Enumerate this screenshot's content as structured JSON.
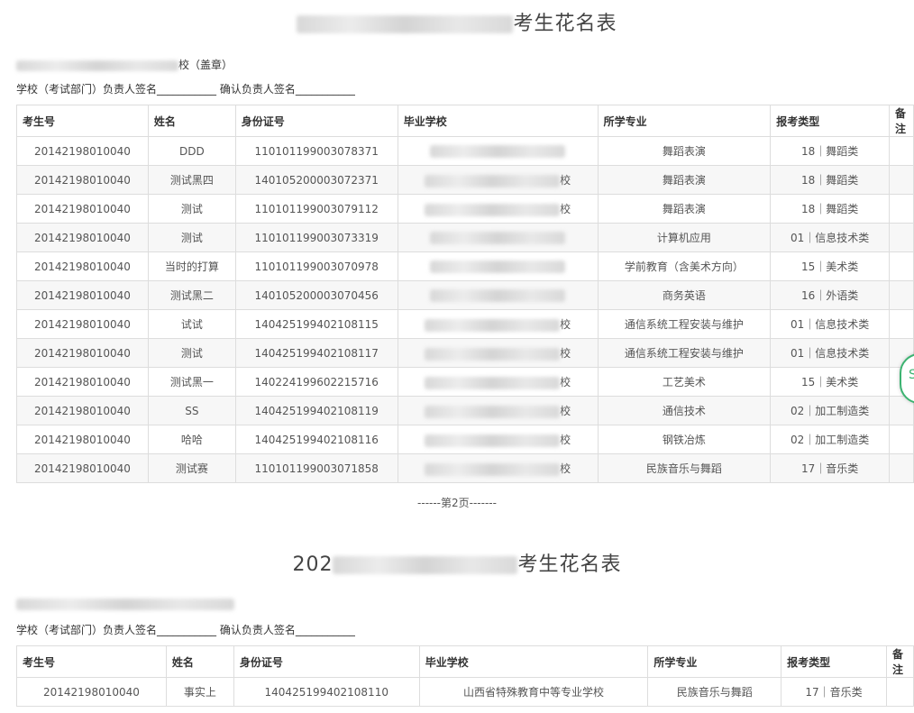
{
  "sheet1": {
    "title_suffix": "考生花名表",
    "school_suffix": "校（盖章）",
    "sign_line": "学校（考试部门）负责人签名___________ 确认负责人签名___________",
    "headers": [
      "考生号",
      "姓名",
      "身份证号",
      "毕业学校",
      "所学专业",
      "报考类型",
      "备注"
    ],
    "rows": [
      [
        "20142198010040",
        "DDD",
        "110101199003078371",
        "",
        "舞蹈表演",
        "18｜舞蹈类",
        ""
      ],
      [
        "20142198010040",
        "测试黑四",
        "140105200003072371",
        "校",
        "舞蹈表演",
        "18｜舞蹈类",
        ""
      ],
      [
        "20142198010040",
        "测试",
        "110101199003079112",
        "校",
        "舞蹈表演",
        "18｜舞蹈类",
        ""
      ],
      [
        "20142198010040",
        "测试",
        "110101199003073319",
        "",
        "计算机应用",
        "01｜信息技术类",
        ""
      ],
      [
        "20142198010040",
        "当时的打算",
        "110101199003070978",
        "",
        "学前教育（含美术方向）",
        "15｜美术类",
        ""
      ],
      [
        "20142198010040",
        "测试黑二",
        "140105200003070456",
        "",
        "商务英语",
        "16｜外语类",
        ""
      ],
      [
        "20142198010040",
        "试试",
        "140425199402108115",
        "校",
        "通信系统工程安装与维护",
        "01｜信息技术类",
        ""
      ],
      [
        "20142198010040",
        "测试",
        "140425199402108117",
        "校",
        "通信系统工程安装与维护",
        "01｜信息技术类",
        ""
      ],
      [
        "20142198010040",
        "测试黑一",
        "140224199602215716",
        "校",
        "工艺美术",
        "15｜美术类",
        ""
      ],
      [
        "20142198010040",
        "SS",
        "140425199402108119",
        "校",
        "通信技术",
        "02｜加工制造类",
        ""
      ],
      [
        "20142198010040",
        "哈哈",
        "140425199402108116",
        "校",
        "钢铁冶炼",
        "02｜加工制造类",
        ""
      ],
      [
        "20142198010040",
        "测试赛",
        "110101199003071858",
        "校",
        "民族音乐与舞蹈",
        "17｜音乐类",
        ""
      ]
    ]
  },
  "pager": "------第2页-------",
  "sheet2": {
    "title_prefix": "202",
    "title_suffix": "考生花名表",
    "sign_line": "学校（考试部门）负责人签名___________ 确认负责人签名___________",
    "headers": [
      "考生号",
      "姓名",
      "身份证号",
      "毕业学校",
      "所学专业",
      "报考类型",
      "备注"
    ],
    "rows": [
      [
        "20142198010040",
        "事实上",
        "140425199402108110",
        "山西省特殊教育中等专业学校",
        "民族音乐与舞蹈",
        "17｜音乐类",
        ""
      ]
    ]
  },
  "widget": {
    "label": "S",
    "icon": "chat-bubble-icon"
  }
}
